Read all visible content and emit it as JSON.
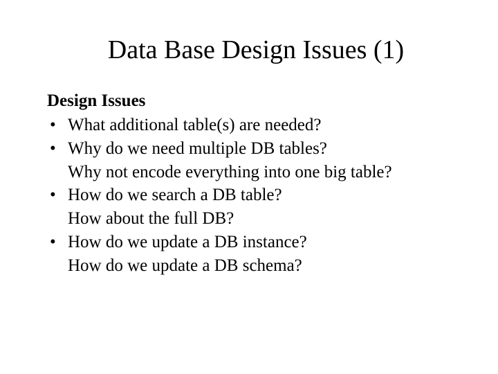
{
  "title": "Data Base Design Issues (1)",
  "section_heading": "Design Issues",
  "bullets": [
    {
      "line1": "What additional table(s) are needed?"
    },
    {
      "line1": "Why do we need multiple DB tables?",
      "line2": "Why not encode everything into one big table?"
    },
    {
      "line1": "How do we search a DB table?",
      "line2": "How about the full DB?"
    },
    {
      "line1": "How do we update a DB instance?",
      "line2": "How do we update a DB schema?"
    }
  ]
}
